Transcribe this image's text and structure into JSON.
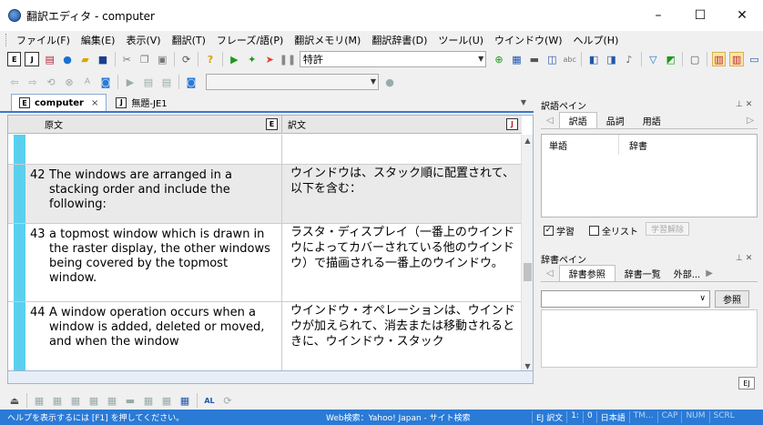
{
  "window": {
    "title": "翻訳エディタ - computer",
    "minimize": "–",
    "maximize": "☐",
    "close": "✕"
  },
  "menu": [
    "ファイル(F)",
    "編集(E)",
    "表示(V)",
    "翻訳(T)",
    "フレーズ/語(P)",
    "翻訳メモリ(M)",
    "翻訳辞書(D)",
    "ツール(U)",
    "ウインドウ(W)",
    "ヘルプ(H)"
  ],
  "toolbar": {
    "domain_combo": "特許"
  },
  "tabs": [
    {
      "label": "computer",
      "icon": "E",
      "close": "×"
    },
    {
      "label": "無題-JE1",
      "icon": "J"
    }
  ],
  "editor": {
    "source_header": "原文",
    "target_header": "訳文",
    "source_icon": "E",
    "target_icon": "J",
    "segments": [
      {
        "num": "42",
        "src": "The windows are arranged in a stacking order and include the following:",
        "tgt": "ウインドウは、スタック順に配置されて、以下を含む："
      },
      {
        "num": "43",
        "src": "a topmost window which is drawn in the raster display, the other windows being covered by the topmost window.",
        "tgt": "ラスタ・ディスプレイ（一番上のウインドウによってカバーされている他のウインドウ）で描画される一番上のウインドウ。"
      },
      {
        "num": "44",
        "src": "A window operation occurs when a window is added, deleted or moved, and when the window",
        "tgt": "ウインドウ・オペレーションは、ウインドウが加えられて、消去または移動されるときに、ウインドウ・スタック"
      }
    ]
  },
  "translation_pane": {
    "title": "訳語ペイン",
    "tabs": [
      "訳語",
      "品詞",
      "用語"
    ],
    "col_word": "単語",
    "col_dict": "辞書",
    "learn": "学習",
    "all_list": "全リスト",
    "unlearn": "学習解除"
  },
  "dict_pane": {
    "title": "辞書ペイン",
    "tabs": [
      "辞書参照",
      "辞書一覧",
      "外部..."
    ],
    "ref_button": "参照",
    "ej": "EJ"
  },
  "status": {
    "help": "ヘルプを表示するには [F1] を押してください。",
    "web": "Web検索：Yahoo! Japan - サイト検索",
    "cells": [
      "EJ 訳文",
      "1:",
      "0",
      "日本語",
      "TM...",
      "CAP",
      "NUM",
      "SCRL"
    ]
  }
}
